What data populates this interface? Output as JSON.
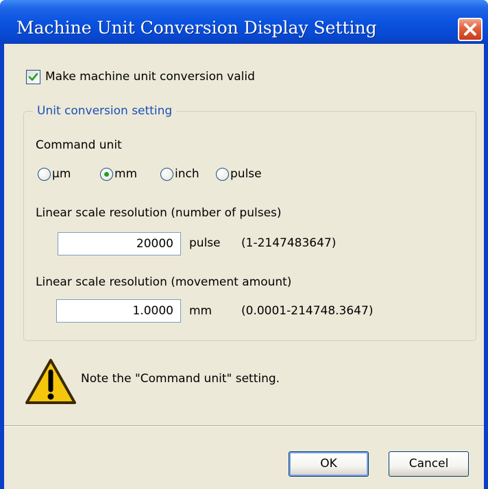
{
  "window": {
    "title": "Machine Unit Conversion Display Setting",
    "close_icon": "close-icon"
  },
  "enable_checkbox": {
    "label": "Make machine unit conversion valid",
    "checked": true
  },
  "unit_group": {
    "legend": "Unit conversion setting",
    "command_unit": {
      "label": "Command unit",
      "options": [
        "μm",
        "mm",
        "inch",
        "pulse"
      ],
      "selected": "mm"
    },
    "pulses": {
      "label": "Linear scale resolution (number of pulses)",
      "value": "20000",
      "unit": "pulse",
      "range": "(1-2147483647)"
    },
    "movement": {
      "label": "Linear scale resolution (movement amount)",
      "value": "1.0000",
      "unit": "mm",
      "range": "(0.0001-214748.3647)"
    }
  },
  "note": {
    "icon": "warning-icon",
    "text": "Note the \"Command unit\" setting."
  },
  "buttons": {
    "ok": "OK",
    "cancel": "Cancel"
  },
  "colors": {
    "titlebar": "#0a53e0",
    "dialog_bg": "#ece9d8",
    "group_legend": "#1a4fb8",
    "radio_dot": "#21a121",
    "close_button": "#e0603c",
    "warning_fill": "#f5c70c"
  }
}
